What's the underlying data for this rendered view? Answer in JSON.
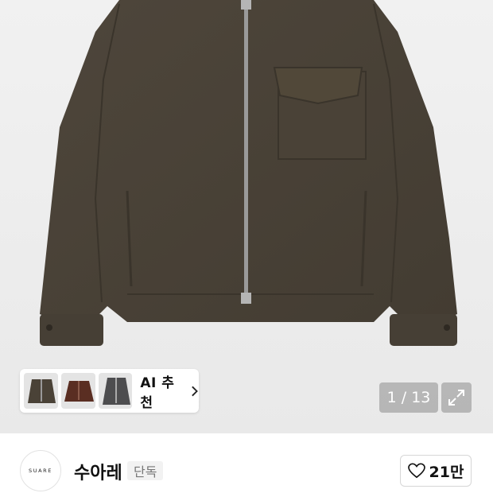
{
  "gallery": {
    "image_alt": "olive wool zip jacket",
    "counter": "1 / 13",
    "expand_icon": "expand-arrows-icon"
  },
  "ai_recommend": {
    "label": "AI 추천",
    "chevron_icon": "chevron-right-icon",
    "thumbnails": [
      "olive-jacket-thumb",
      "brown-jacket-thumb",
      "gray-jacket-thumb"
    ]
  },
  "store": {
    "logo_text": "SUARE",
    "name": "수아레",
    "badge": "단독",
    "like_count": "21만",
    "like_icon": "heart-outline-icon"
  },
  "colors": {
    "jacket": "#4a4237",
    "background": "#ececec",
    "accent": "#111111"
  }
}
